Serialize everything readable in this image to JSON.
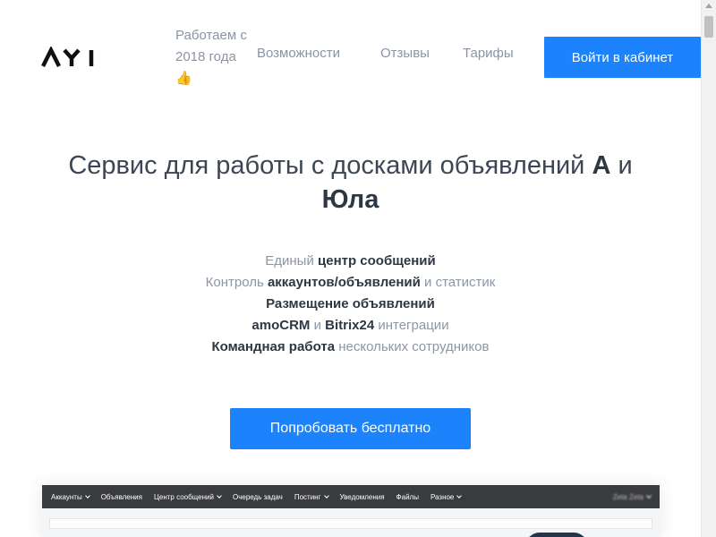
{
  "header": {
    "since_text": "Работаем с 2018 года 👍",
    "nav": {
      "features": "Возможности",
      "reviews": "Отзывы",
      "pricing": "Тарифы"
    },
    "login_label": "Войти в кабинет"
  },
  "hero": {
    "title_part1": "Сервис для работы с досками объявлений ",
    "title_bold1": "А",
    "title_part2": " и ",
    "title_bold2": "Юла"
  },
  "features": [
    {
      "pre": "Единый ",
      "bold": "центр сообщений",
      "post": ""
    },
    {
      "pre": "Контроль ",
      "bold": "аккаунтов/объявлений",
      "post": " и статистик"
    },
    {
      "pre": "",
      "bold": "Размещение объявлений",
      "post": ""
    },
    {
      "pre": "",
      "bold": "amoCRM",
      "mid": " и ",
      "bold2": "Bitrix24",
      "post": " интеграции"
    },
    {
      "pre": "",
      "bold": "Командная работа",
      "post": " нескольких сотрудников"
    }
  ],
  "cta_label": "Попробовать бесплатно",
  "preview": {
    "menu": [
      "Аккаунты",
      "Объявления",
      "Центр сообщений",
      "Очередь задач",
      "Постинг",
      "Уведомления",
      "Файлы",
      "Разное"
    ],
    "menu_has_dropdown": [
      true,
      false,
      true,
      false,
      true,
      false,
      false,
      true
    ],
    "user_name": "Zeta Zeta"
  },
  "colors": {
    "accent": "#1c83fc",
    "text_dark": "#2e3744",
    "text_muted": "#8d96a5"
  }
}
